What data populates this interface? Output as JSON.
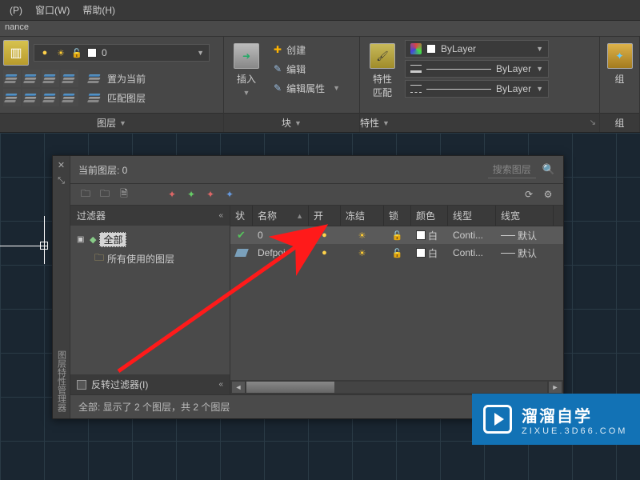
{
  "menubar": {
    "items": [
      "(P)",
      "窗口(W)",
      "帮助(H)"
    ]
  },
  "subhead": "nance",
  "ribbon": {
    "layer": {
      "title": "图层",
      "current_layer": "0",
      "btn_set_current": "置为当前",
      "btn_match": "匹配图层"
    },
    "block": {
      "title": "块",
      "insert": "插入",
      "create": "创建",
      "edit": "编辑",
      "edit_attrs": "编辑属性"
    },
    "props": {
      "title": "特性",
      "match": "特性\n匹配",
      "bylayer": "ByLayer"
    },
    "group": {
      "title": "组"
    }
  },
  "palette": {
    "title": "当前图层: 0",
    "search_placeholder": "搜索图层",
    "vtitle": "图层特性管理器",
    "filter": {
      "head": "过滤器",
      "root": "全部",
      "child": "所有使用的图层",
      "invert": "反转过滤器(I)"
    },
    "grid": {
      "columns": {
        "status": "状",
        "name": "名称",
        "on": "开",
        "freeze": "冻结",
        "lock": "锁",
        "color": "颜色",
        "ltype": "线型",
        "lw": "线宽"
      },
      "rows": [
        {
          "status": "current",
          "name": "0",
          "on": true,
          "frozen": false,
          "locked": false,
          "color": "白",
          "ltype": "Conti...",
          "lw": "默认"
        },
        {
          "status": "normal",
          "name": "Defpoi",
          "on": true,
          "frozen": false,
          "locked": false,
          "color": "白",
          "ltype": "Conti...",
          "lw": "默认"
        }
      ]
    },
    "status": "全部: 显示了 2 个图层，共 2 个图层"
  },
  "badge": {
    "zh": "溜溜自学",
    "en": "ZIXUE.3D66.COM"
  }
}
